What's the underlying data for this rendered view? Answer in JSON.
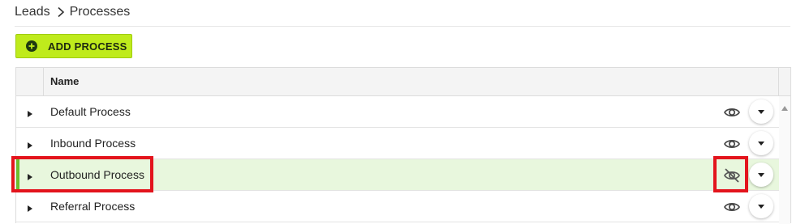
{
  "breadcrumb": {
    "items": [
      "Leads",
      "Processes"
    ],
    "separator_icon": "chevron-right-icon"
  },
  "toolbar": {
    "add_label": "ADD PROCESS",
    "add_icon": "plus-circle-icon",
    "accent_color": "#bfeb1c"
  },
  "grid": {
    "columns": [
      {
        "label": "Name"
      }
    ],
    "rows": [
      {
        "name": "Default Process",
        "visibility": "visible",
        "selected": false
      },
      {
        "name": "Inbound Process",
        "visibility": "visible",
        "selected": false
      },
      {
        "name": "Outbound Process",
        "visibility": "hidden",
        "selected": true
      },
      {
        "name": "Referral Process",
        "visibility": "visible",
        "selected": false
      }
    ]
  },
  "colors": {
    "selected_row_bg": "#e8f7dd",
    "selected_row_bar": "#6ebd2d",
    "highlight_annotation": "#e3141c"
  }
}
